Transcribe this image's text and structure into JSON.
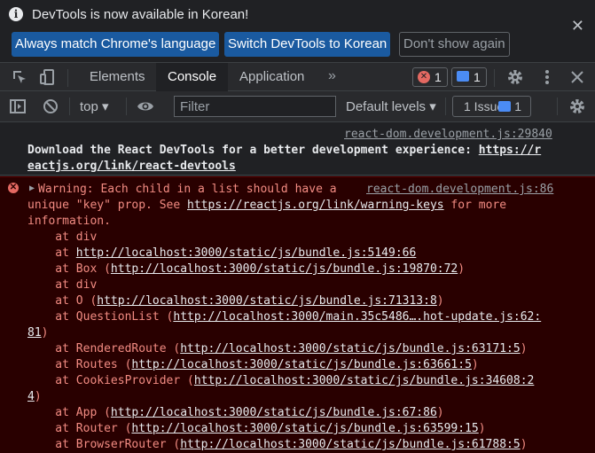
{
  "banner": {
    "title": "DevTools is now available in Korean!",
    "close": "✕",
    "buttons": [
      {
        "label": "Always match Chrome's language"
      },
      {
        "label": "Switch DevTools to Korean"
      },
      {
        "label": "Don't show again"
      }
    ]
  },
  "tabs": {
    "items": [
      {
        "label": "Elements"
      },
      {
        "label": "Console"
      },
      {
        "label": "Application"
      }
    ],
    "more": "»",
    "error_count": "1",
    "message_count": "1"
  },
  "toolbar": {
    "context": "top ▾",
    "filter_placeholder": "Filter",
    "levels": "Default levels ▾",
    "issues_label": "1 Issue:",
    "issues_count": "1"
  },
  "console": {
    "info": {
      "source": "react-dom.development.js:29840",
      "line1": "Download the React DevTools for a better development experience: ",
      "link_a": "https://r",
      "link_b": "eactjs.org/link/react-devtools"
    },
    "error": {
      "source": "react-dom.development.js:86",
      "l1": "Warning: Each child in a list should have a",
      "l2a": "unique \"key\" prop. See ",
      "l2link": "https://reactjs.org/link/warning-keys",
      "l2b": " for more",
      "l3": "information.",
      "stack": [
        {
          "pre": "    at div",
          "url": "",
          "post": ""
        },
        {
          "pre": "    at ",
          "url": "http://localhost:3000/static/js/bundle.js:5149:66",
          "post": ""
        },
        {
          "pre": "    at Box (",
          "url": "http://localhost:3000/static/js/bundle.js:19870:72",
          "post": ")"
        },
        {
          "pre": "    at div",
          "url": "",
          "post": ""
        },
        {
          "pre": "    at O (",
          "url": "http://localhost:3000/static/js/bundle.js:71313:8",
          "post": ")"
        },
        {
          "pre": "    at QuestionList (",
          "url": "http://localhost:3000/main.35c5486….hot-update.js:62:",
          "post": ""
        },
        {
          "pre": "",
          "url": "81",
          "post": ")"
        },
        {
          "pre": "    at RenderedRoute (",
          "url": "http://localhost:3000/static/js/bundle.js:63171:5",
          "post": ")"
        },
        {
          "pre": "    at Routes (",
          "url": "http://localhost:3000/static/js/bundle.js:63661:5",
          "post": ")"
        },
        {
          "pre": "    at CookiesProvider (",
          "url": "http://localhost:3000/static/js/bundle.js:34608:2",
          "post": ""
        },
        {
          "pre": "",
          "url": "4",
          "post": ")"
        },
        {
          "pre": "    at App (",
          "url": "http://localhost:3000/static/js/bundle.js:67:86",
          "post": ")"
        },
        {
          "pre": "    at Router (",
          "url": "http://localhost:3000/static/js/bundle.js:63599:15",
          "post": ")"
        },
        {
          "pre": "    at BrowserRouter (",
          "url": "http://localhost:3000/static/js/bundle.js:61788:5",
          "post": ")"
        }
      ]
    }
  },
  "colors": {
    "accent": "#1a5aa0",
    "error_bg": "#290000",
    "error_text": "#f28b82"
  },
  "icons": [
    "info-icon",
    "inspect-icon",
    "device-toggle-icon",
    "gear-icon",
    "kebab-menu-icon",
    "close-icon",
    "sidebar-icon",
    "clear-console-icon",
    "eye-icon",
    "error-icon",
    "message-icon",
    "expand-triangle-icon"
  ]
}
